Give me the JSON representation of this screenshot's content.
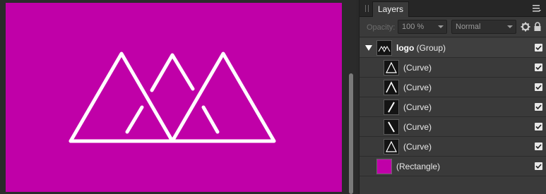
{
  "canvas": {
    "artboard_color": "#c000a8",
    "artboard_name": "canvas-artboard"
  },
  "panel": {
    "tab_label": "Layers",
    "opacity_label": "Opacity:",
    "opacity_value": "100 %",
    "blend_mode": "Normal"
  },
  "layers": {
    "group": {
      "name": "logo",
      "kind": "(Group)",
      "visible": true,
      "expanded": true
    },
    "children": [
      {
        "label": "(Curve)",
        "icon": "triangle-outline",
        "visible": true
      },
      {
        "label": "(Curve)",
        "icon": "peak-outline",
        "visible": true
      },
      {
        "label": "(Curve)",
        "icon": "slash-forward",
        "visible": true
      },
      {
        "label": "(Curve)",
        "icon": "slash-back",
        "visible": true
      },
      {
        "label": "(Curve)",
        "icon": "triangle-outline",
        "visible": true
      }
    ],
    "rectangle": {
      "label": "(Rectangle)",
      "color": "#c000a8",
      "visible": true
    }
  }
}
